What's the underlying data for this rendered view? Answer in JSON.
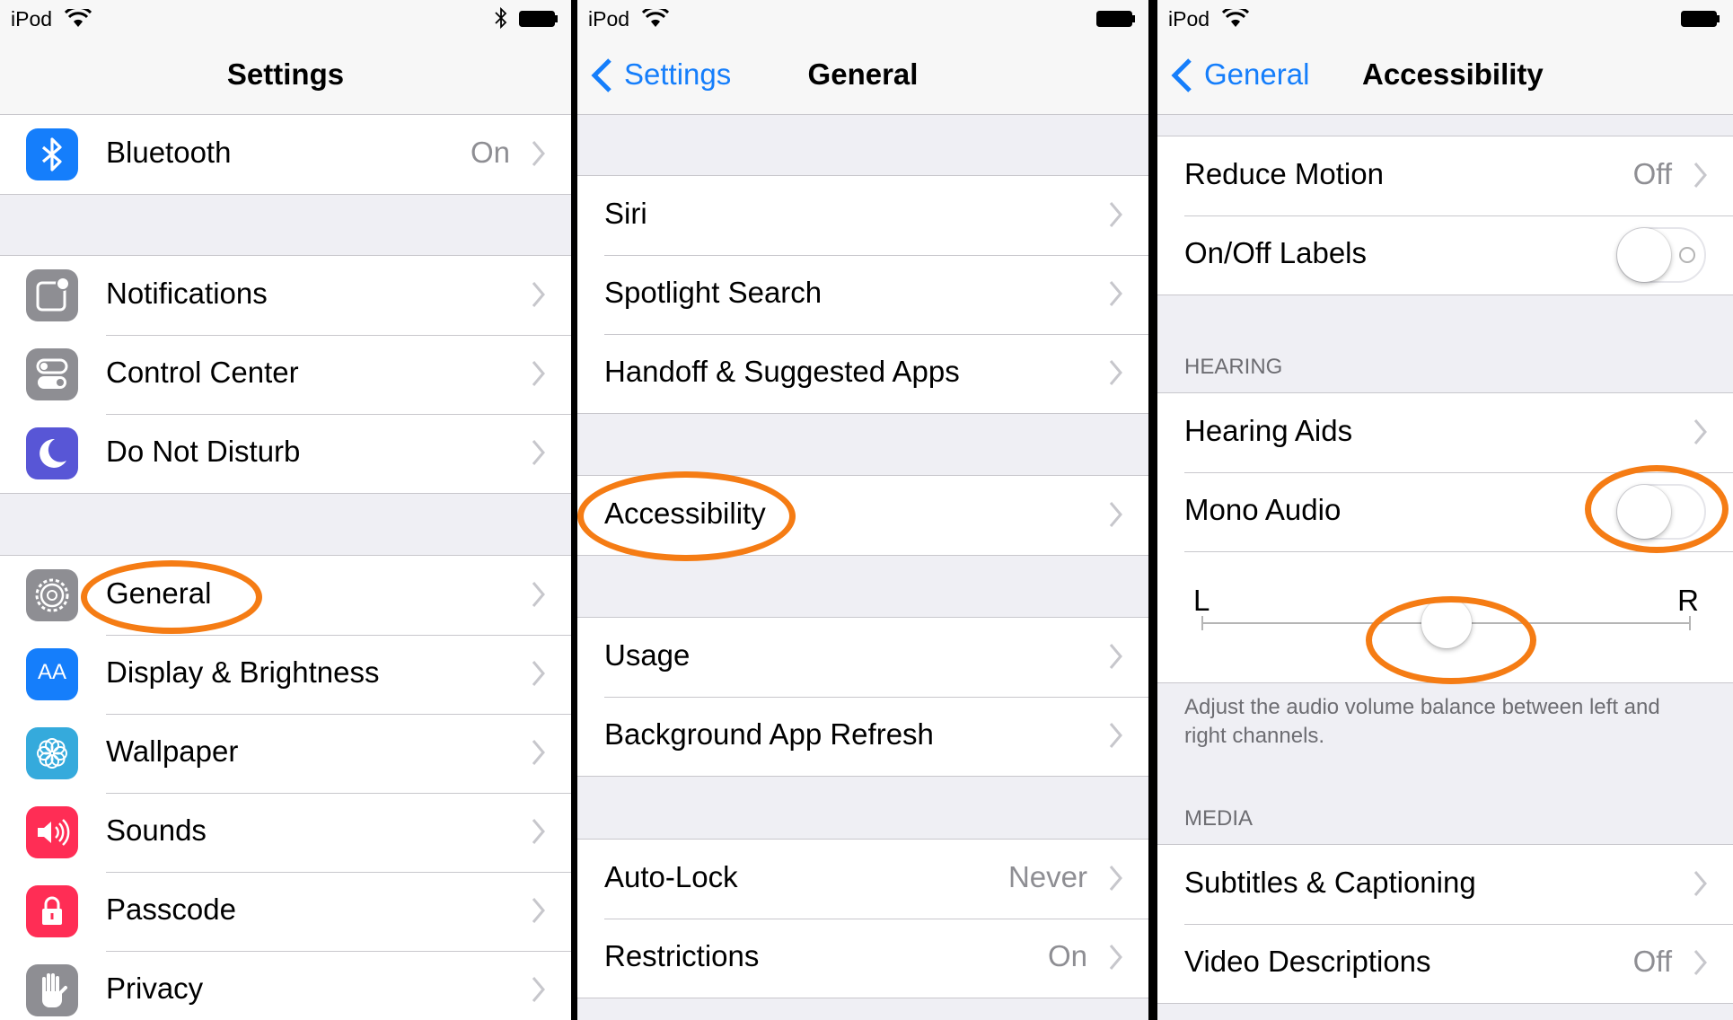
{
  "status": {
    "carrier": "iPod"
  },
  "colors": {
    "ios_blue": "#157efb",
    "highlight": "#f57c14",
    "separator": "#c8c7cc",
    "group_bg": "#efeff4"
  },
  "panel1": {
    "title": "Settings",
    "rows": {
      "bluetooth": {
        "label": "Bluetooth",
        "value": "On",
        "icon": "bluetooth-icon",
        "icon_color": "#157efb"
      },
      "notifications": {
        "label": "Notifications",
        "icon": "notifications-icon",
        "icon_color": "#8e8e93"
      },
      "control_center": {
        "label": "Control Center",
        "icon": "control-center-icon",
        "icon_color": "#8e8e93"
      },
      "do_not_disturb": {
        "label": "Do Not Disturb",
        "icon": "moon-icon",
        "icon_color": "#5856d6"
      },
      "general": {
        "label": "General",
        "icon": "gear-icon",
        "icon_color": "#8e8e93"
      },
      "display": {
        "label": "Display & Brightness",
        "icon": "display-icon",
        "icon_color": "#157efb",
        "icon_text": "AA"
      },
      "wallpaper": {
        "label": "Wallpaper",
        "icon": "wallpaper-icon",
        "icon_color": "#35aadc"
      },
      "sounds": {
        "label": "Sounds",
        "icon": "speaker-icon",
        "icon_color": "#ff2d55"
      },
      "passcode": {
        "label": "Passcode",
        "icon": "lock-icon",
        "icon_color": "#ff2d55"
      },
      "privacy": {
        "label": "Privacy",
        "icon": "hand-icon",
        "icon_color": "#8e8e93"
      }
    }
  },
  "panel2": {
    "back": "Settings",
    "title": "General",
    "rows": {
      "siri": {
        "label": "Siri"
      },
      "spotlight": {
        "label": "Spotlight Search"
      },
      "handoff": {
        "label": "Handoff & Suggested Apps"
      },
      "accessibility": {
        "label": "Accessibility"
      },
      "usage": {
        "label": "Usage"
      },
      "bg_refresh": {
        "label": "Background App Refresh"
      },
      "auto_lock": {
        "label": "Auto-Lock",
        "value": "Never"
      },
      "restrictions": {
        "label": "Restrictions",
        "value": "On"
      }
    }
  },
  "panel3": {
    "back": "General",
    "title": "Accessibility",
    "rows": {
      "reduce_motion": {
        "label": "Reduce Motion",
        "value": "Off"
      },
      "onoff_labels": {
        "label": "On/Off Labels",
        "toggle_on": false
      },
      "hearing_aids": {
        "label": "Hearing Aids"
      },
      "mono_audio": {
        "label": "Mono Audio",
        "toggle_on": false
      },
      "subtitles": {
        "label": "Subtitles & Captioning"
      },
      "video_desc": {
        "label": "Video Descriptions",
        "value": "Off"
      }
    },
    "hearing_header": "HEARING",
    "media_header": "MEDIA",
    "balance": {
      "left": "L",
      "right": "R",
      "value": 0.5
    },
    "balance_note": "Adjust the audio volume balance between left and right channels."
  }
}
